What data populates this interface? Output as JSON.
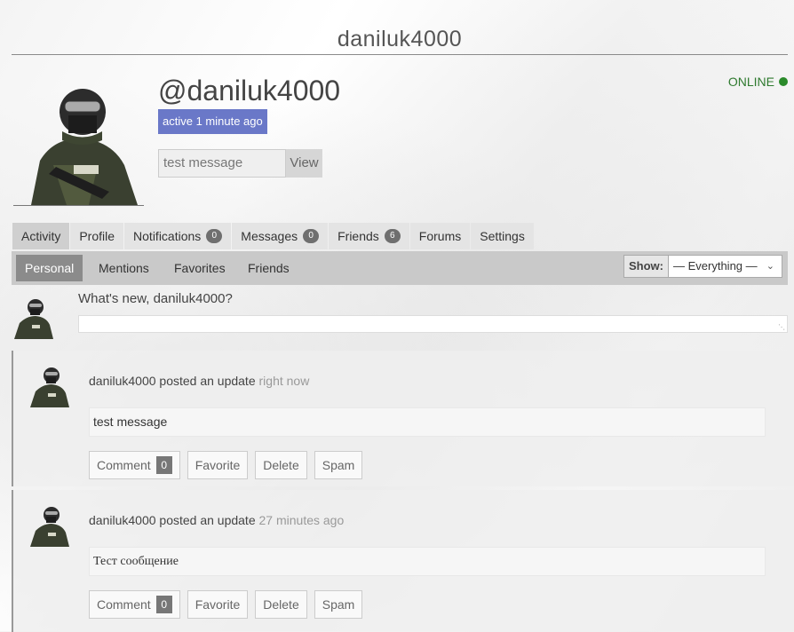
{
  "header": {
    "title": "daniluk4000"
  },
  "profile": {
    "mention": "@daniluk4000",
    "active": "active 1 minute ago",
    "status_input_value": "test message",
    "view_label": "View",
    "online_label": "ONLINE"
  },
  "colors": {
    "accent": "#6a78c8",
    "online": "#2a8a2a",
    "subnav": "#c9c9c9"
  },
  "main_nav": {
    "activity": "Activity",
    "profile": "Profile",
    "notifications": "Notifications",
    "notifications_count": "0",
    "messages": "Messages",
    "messages_count": "0",
    "friends": "Friends",
    "friends_count": "6",
    "forums": "Forums",
    "settings": "Settings"
  },
  "sub_nav": {
    "personal": "Personal",
    "mentions": "Mentions",
    "favorites": "Favorites",
    "friends": "Friends",
    "show_label": "Show:",
    "show_value": "— Everything —"
  },
  "whats_new": {
    "label": "What's new, daniluk4000?"
  },
  "activities": [
    {
      "user": "daniluk4000",
      "action": "posted an update",
      "time": "right now",
      "content": "test message",
      "comment_label": "Comment",
      "comment_count": "0",
      "favorite_label": "Favorite",
      "delete_label": "Delete",
      "spam_label": "Spam"
    },
    {
      "user": "daniluk4000",
      "action": "posted an update",
      "time": "27 minutes ago",
      "content": "Тест сообщение",
      "comment_label": "Comment",
      "comment_count": "0",
      "favorite_label": "Favorite",
      "delete_label": "Delete",
      "spam_label": "Spam"
    }
  ]
}
